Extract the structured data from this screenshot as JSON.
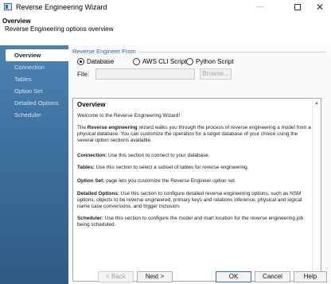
{
  "window": {
    "title": "Reverse Engineering Wizard",
    "minimize": "—",
    "close": "✕"
  },
  "header": {
    "title": "Overview",
    "subtitle": "Reverse Engineering options overview"
  },
  "sidebar": {
    "items": [
      {
        "label": "Overview",
        "active": true
      },
      {
        "label": "Connection",
        "active": false
      },
      {
        "label": "Tables",
        "active": false
      },
      {
        "label": "Option Set",
        "active": false
      },
      {
        "label": "Detailed Options",
        "active": false
      },
      {
        "label": "Scheduler",
        "active": false
      }
    ]
  },
  "source": {
    "group_label": "Reverse Engineer From",
    "options": [
      {
        "label": "Database",
        "selected": true
      },
      {
        "label": "AWS CLI Script",
        "selected": false
      },
      {
        "label": "Python Script",
        "selected": false
      }
    ],
    "file_label": "File:",
    "file_value": "",
    "browse_label": "Browse..."
  },
  "overview": {
    "heading": "Overview",
    "welcome": "Welcome to the Reverse Engineering Wizard!",
    "intro_prefix": "The ",
    "intro_bold": "Reverse engineering",
    "intro_rest": " wizard walks you through the process of reverse engineering a model from a physical database. You can customize the operation for a target database of your choice using the several option sections available.",
    "connection_bold": "Connection:",
    "connection_rest": " Use this section to connect to your database.",
    "tables_bold": "Tables:",
    "tables_rest": " Use this section to select a subset of tables for reverse engineering.",
    "optionset_bold": "Option Set:",
    "optionset_rest": " page lets you customize the Reverse Engineer option set.",
    "detailed_bold": "Detailed Options:",
    "detailed_rest": " Use this section to configure detailed reverse engineering options, such as NSM options, objects to be reverse engineered, primary keys and relations inference, physical and logical name case conversions, and trigger inclusion.",
    "scheduler_bold": "Scheduler:",
    "scheduler_rest": " Use this section to configure the model and mart location for the reverse engineering job being scheduled."
  },
  "footer": {
    "back": "< Back",
    "next": "Next >",
    "ok": "OK",
    "cancel": "Cancel",
    "help": "Help"
  }
}
